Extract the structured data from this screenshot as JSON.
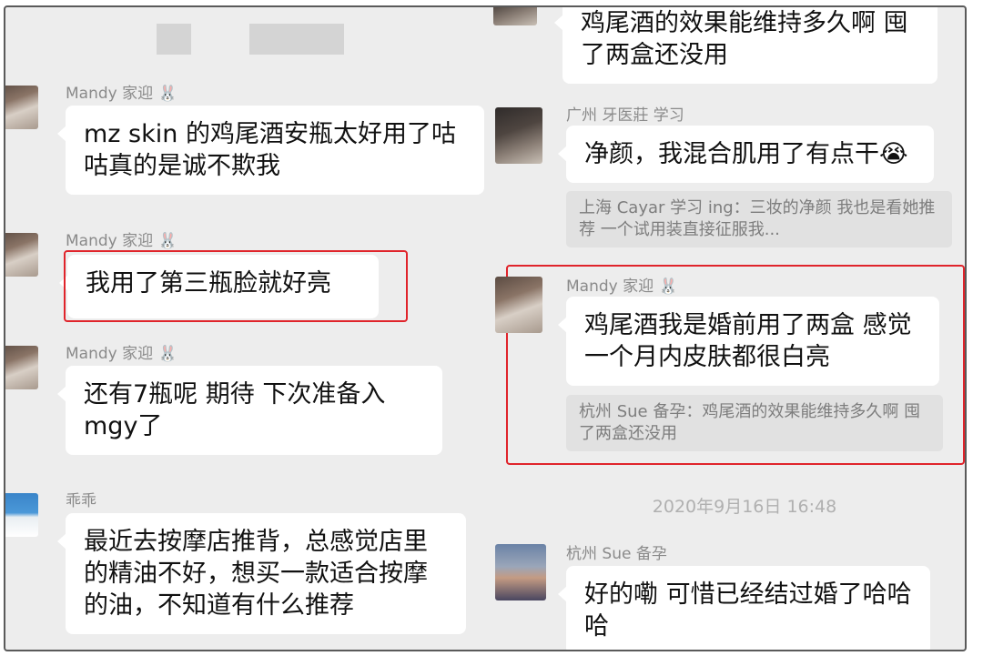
{
  "left": {
    "messages": [
      {
        "name": "Mandy 家迎",
        "text": "mz skin 的鸡尾酒安瓶太好用了咕咕真的是诚不欺我"
      },
      {
        "name": "Mandy 家迎",
        "text": "我用了第三瓶脸就好亮"
      },
      {
        "name": "Mandy 家迎",
        "text": "还有7瓶呢 期待 下次准备入mgy了"
      },
      {
        "name": "乖乖",
        "text": "最近去按摩店推背，总感觉店里的精油不好，想买一款适合按摩的油，不知道有什么推荐"
      }
    ]
  },
  "right": {
    "top_text": "鸡尾酒的效果能维持多久啊 囤了两盒还没用",
    "messages": [
      {
        "name": "广州 牙医莊 学习",
        "text": "净颜，我混合肌用了有点干😭",
        "quote": "上海 Cayar 学习 ing：三妆的净颜 我也是看她推荐 一个试用装直接征服我..."
      },
      {
        "name": "Mandy 家迎",
        "text": "鸡尾酒我是婚前用了两盒 感觉一个月内皮肤都很白亮",
        "quote": "杭州 Sue 备孕：鸡尾酒的效果能维持多久啊 囤了两盒还没用"
      },
      {
        "name": "杭州 Sue 备孕",
        "text": "好的嘞 可惜已经结过婚了哈哈哈"
      }
    ],
    "timestamp": "2020年9月16日 16:48"
  },
  "icons": {
    "bunny": "🐰"
  },
  "colors": {
    "highlight": "#e0242b",
    "background": "#ededed"
  }
}
